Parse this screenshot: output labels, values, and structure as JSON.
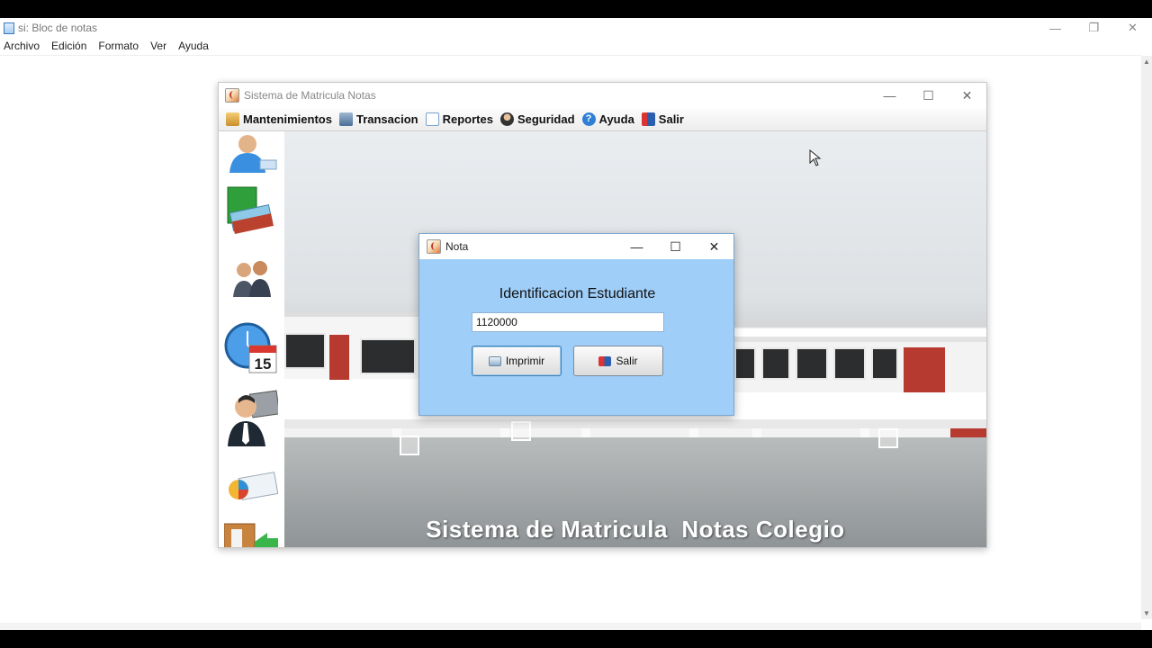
{
  "notepad": {
    "title": "si: Bloc de notas",
    "menu": [
      "Archivo",
      "Edición",
      "Formato",
      "Ver",
      "Ayuda"
    ],
    "controls": {
      "minimize": "—",
      "restore": "❐",
      "close": "✕"
    }
  },
  "app": {
    "title": "Sistema de Matricula Notas",
    "controls": {
      "minimize": "—",
      "maximize": "☐",
      "close": "✕"
    },
    "menu": [
      {
        "label": "Mantenimientos",
        "icon": "folder-icon",
        "color": "#d9a441"
      },
      {
        "label": "Transacion",
        "icon": "transaction-icon",
        "color": "#5a7fa8"
      },
      {
        "label": "Reportes",
        "icon": "report-icon",
        "color": "#7aa2cc"
      },
      {
        "label": "Seguridad",
        "icon": "security-user-icon",
        "color": "#444444"
      },
      {
        "label": "Ayuda",
        "icon": "help-icon",
        "color": "#2f7fd4"
      },
      {
        "label": "Salir",
        "icon": "exit-door-icon",
        "color": "#2a5fb0"
      }
    ],
    "sidebar": [
      {
        "name": "student-icon",
        "calendar_day": ""
      },
      {
        "name": "books-icon",
        "calendar_day": ""
      },
      {
        "name": "users-icon",
        "calendar_day": ""
      },
      {
        "name": "calendar-clock-icon",
        "calendar_day": "15"
      },
      {
        "name": "teacher-icon",
        "calendar_day": ""
      },
      {
        "name": "reports-chart-icon",
        "calendar_day": ""
      },
      {
        "name": "exit-icon",
        "calendar_day": ""
      }
    ],
    "background_caption": "Sistema de Matricula  Notas Colegio"
  },
  "dialog": {
    "title": "Nota",
    "controls": {
      "minimize": "—",
      "maximize": "☐",
      "close": "✕"
    },
    "label": "Identificacion Estudiante",
    "input_value": "1120000",
    "print_button": "Imprimir",
    "exit_button": "Salir"
  }
}
